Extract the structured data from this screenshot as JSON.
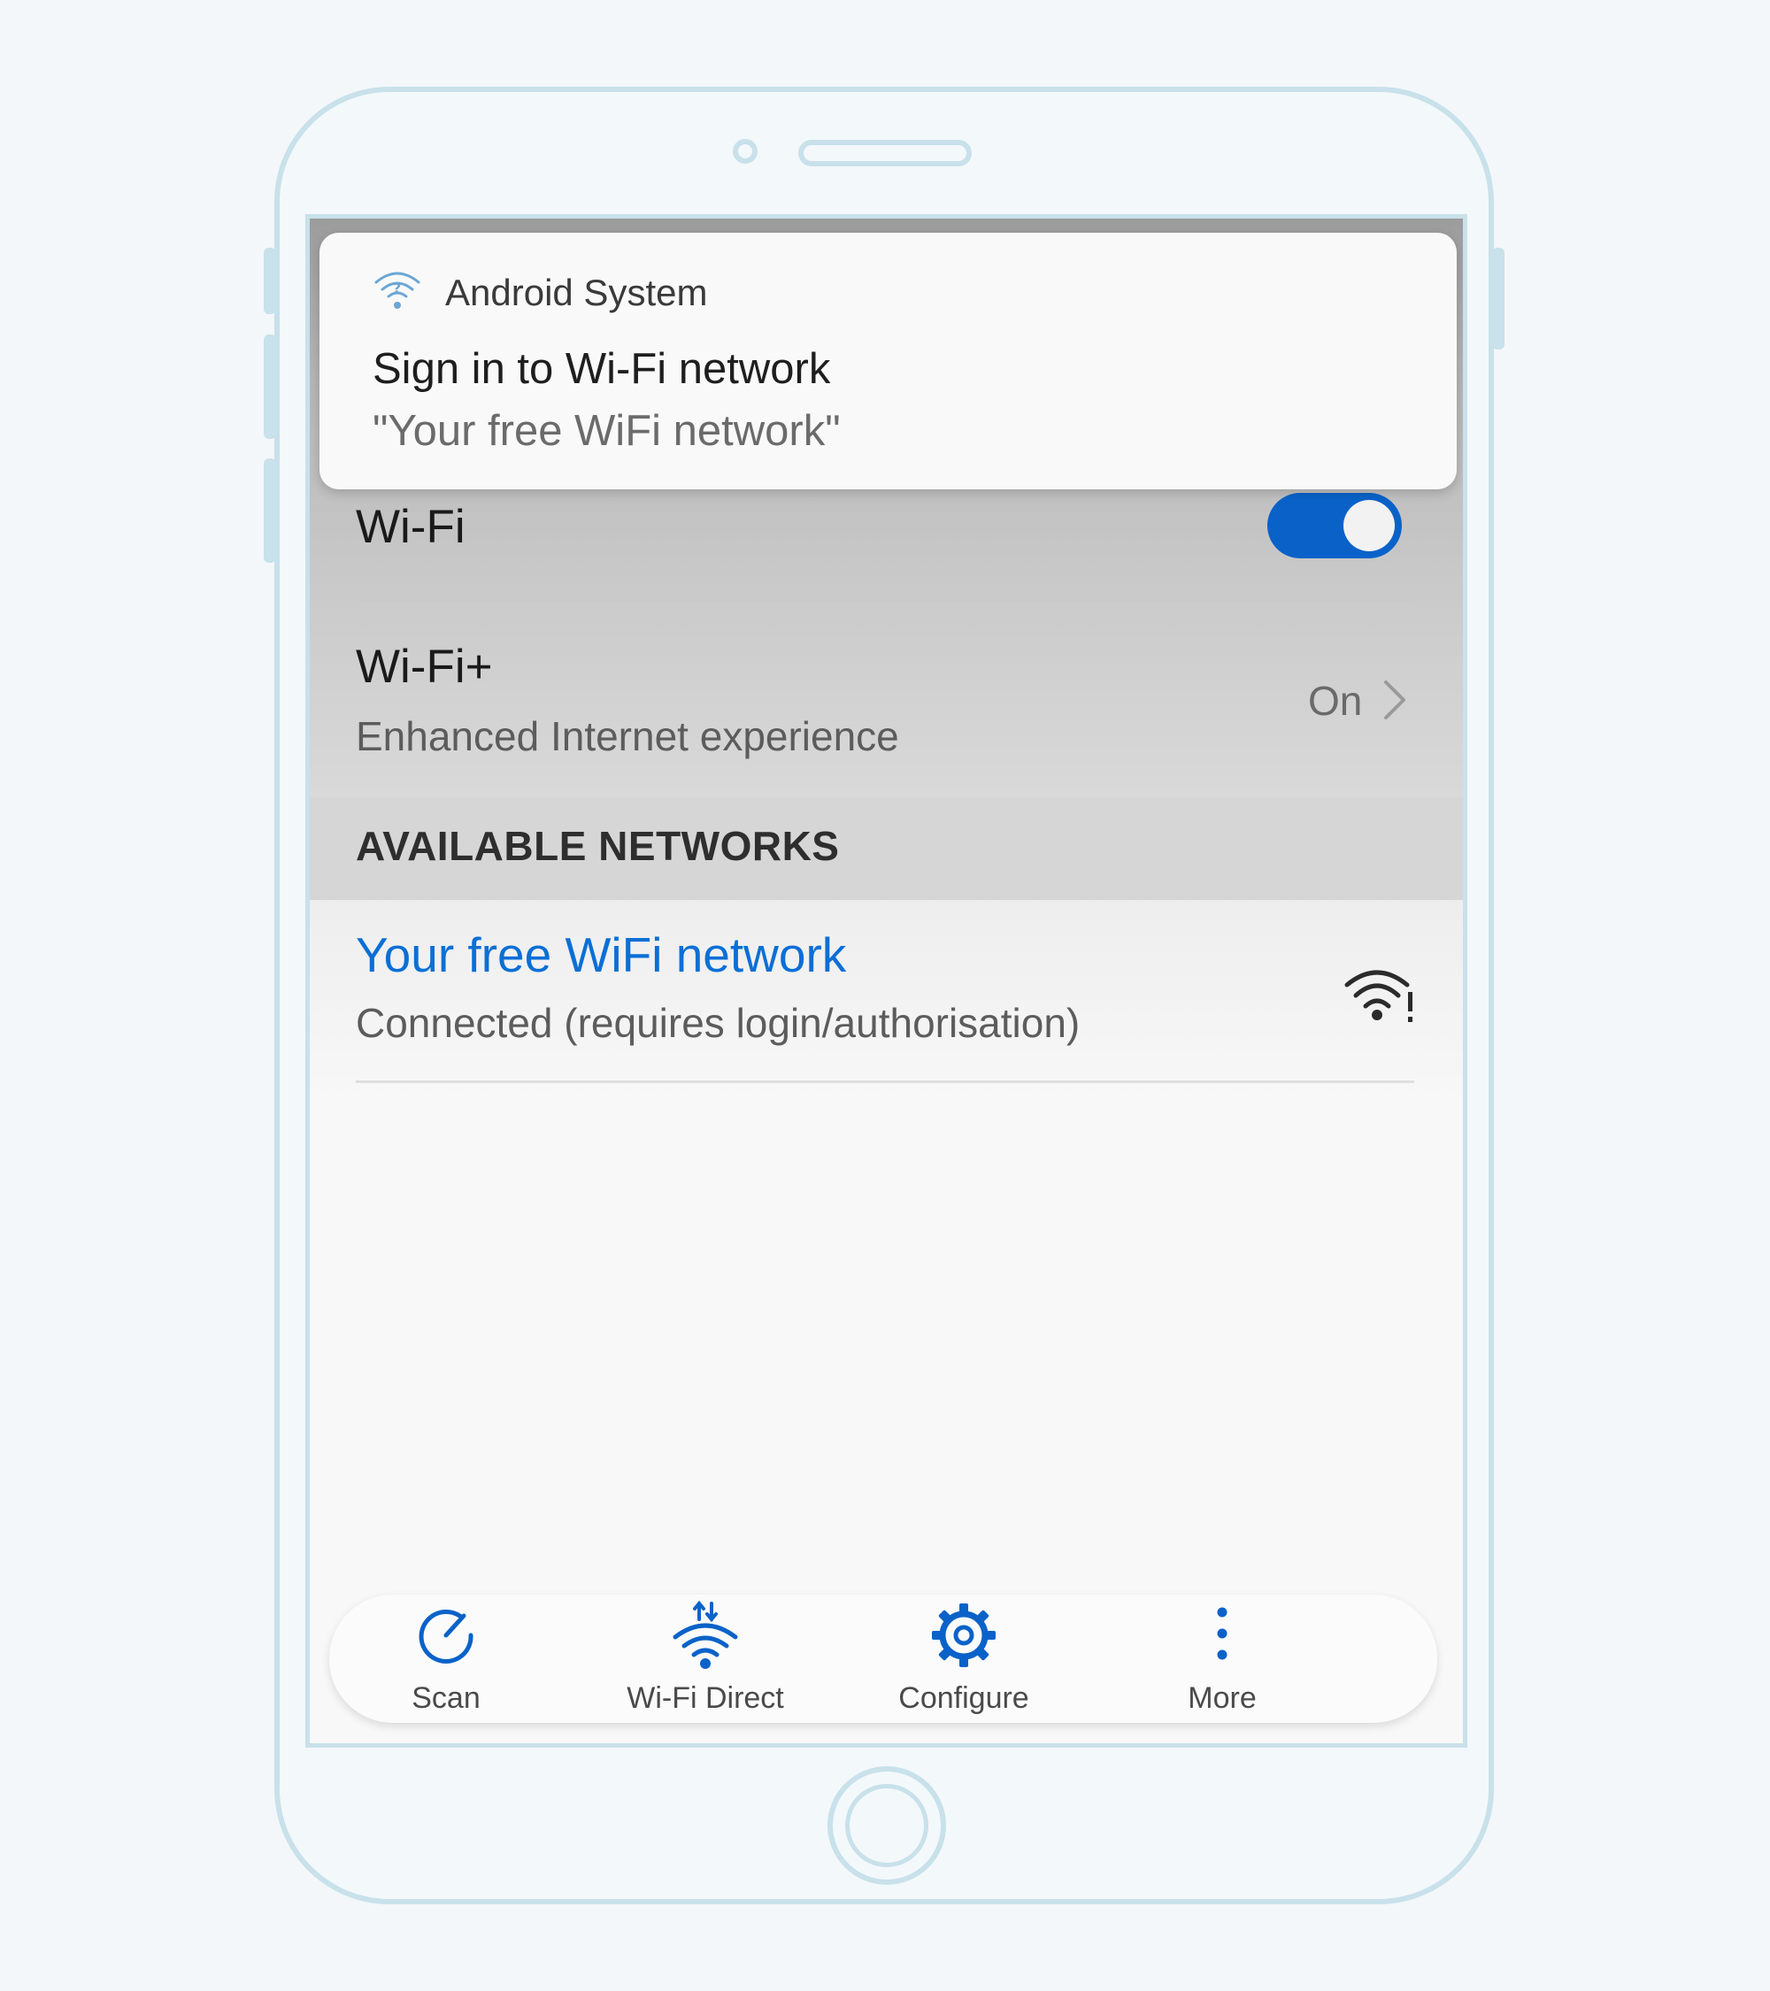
{
  "notification": {
    "app_name": "Android System",
    "title": "Sign in to Wi-Fi network",
    "subtitle": "\"Your free WiFi network\""
  },
  "wifi": {
    "label": "Wi-Fi",
    "enabled": true
  },
  "wifi_plus": {
    "label": "Wi-Fi+",
    "description": "Enhanced Internet experience",
    "value": "On"
  },
  "available_networks": {
    "header": "AVAILABLE NETWORKS",
    "items": [
      {
        "name": "Your free WiFi network",
        "status": "Connected (requires login/authorisation)",
        "icon": "wifi-warning-icon"
      }
    ]
  },
  "toolbar": {
    "items": [
      {
        "label": "Scan",
        "icon": "scan-icon"
      },
      {
        "label": "Wi-Fi Direct",
        "icon": "wifi-direct-icon"
      },
      {
        "label": "Configure",
        "icon": "gear-icon"
      },
      {
        "label": "More",
        "icon": "more-vertical-icon"
      }
    ]
  },
  "colors": {
    "accent": "#0a62c9",
    "link": "#0a6fd6",
    "device_outline": "#c8e1ea"
  }
}
